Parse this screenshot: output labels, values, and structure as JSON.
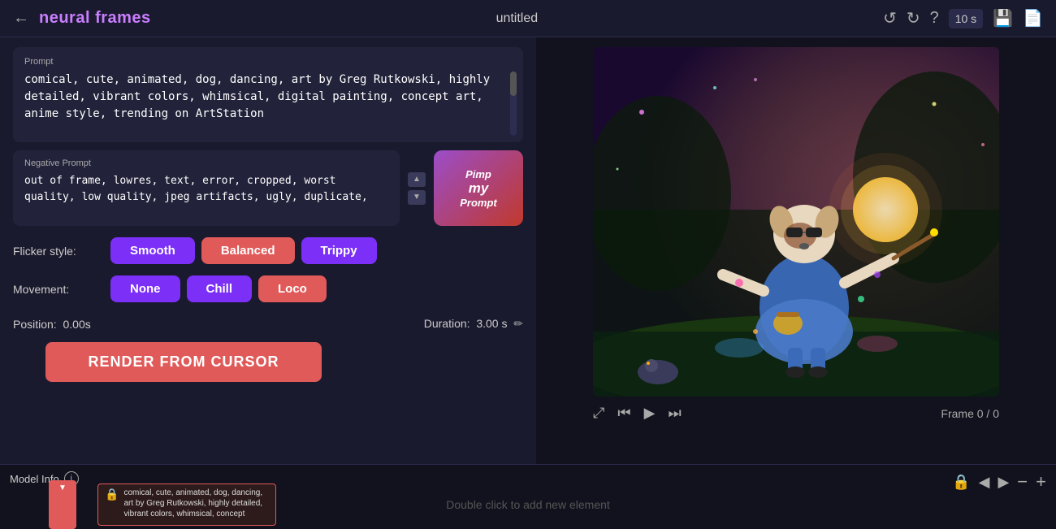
{
  "topbar": {
    "back_icon": "←",
    "brand": "neural frames",
    "title": "untitled",
    "undo_icon": "↺",
    "redo_icon": "↻",
    "help_icon": "?",
    "time_label": "10 s",
    "save_icon": "💾",
    "export_icon": "📄"
  },
  "left_panel": {
    "prompt_label": "Prompt",
    "prompt_text": "comical, cute, animated, dog, dancing, art by Greg Rutkowski, highly detailed, vibrant colors, whimsical, digital painting, concept art, anime style, trending on ArtStation",
    "negative_prompt_label": "Negative Prompt",
    "negative_prompt_text": "out of frame, lowres, text, error, cropped, worst quality, low quality, jpeg artifacts, ugly, duplicate,",
    "pimp_line1": "Pimp",
    "pimp_line2": "my",
    "pimp_line3": "Prompt",
    "flicker_label": "Flicker style:",
    "flicker_buttons": [
      {
        "label": "Smooth",
        "style": "purple"
      },
      {
        "label": "Balanced",
        "style": "salmon"
      },
      {
        "label": "Trippy",
        "style": "purple"
      }
    ],
    "movement_label": "Movement:",
    "movement_buttons": [
      {
        "label": "None",
        "style": "purple"
      },
      {
        "label": "Chill",
        "style": "purple"
      },
      {
        "label": "Loco",
        "style": "salmon"
      }
    ],
    "position_label": "Position:",
    "position_value": "0.00s",
    "duration_label": "Duration:",
    "duration_value": "3.00 s",
    "edit_icon": "✏",
    "render_button": "RENDER FROM CURSOR"
  },
  "right_panel": {
    "expand_icon": "⤢",
    "prev_icon": "⏮",
    "play_icon": "▶",
    "next_icon": "⏭",
    "frame_info": "Frame 0 / 0"
  },
  "bottom_bar": {
    "model_info_label": "Model Info",
    "info_icon": "i",
    "lock_icon": "🔒",
    "arrow_left": "◀",
    "arrow_right": "▶",
    "zoom_out": "−",
    "zoom_in": "+",
    "timeline_hint": "Double click to add new element",
    "timeline_prompt_text": "comical, cute, animated, dog, dancing, art by Greg Rutkowski, highly detailed, vibrant colors, whimsical, concept"
  }
}
